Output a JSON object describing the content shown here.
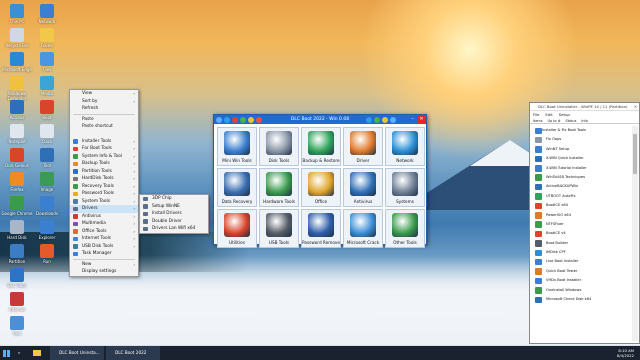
{
  "desktop": {
    "icons_left": [
      {
        "label": "This PC",
        "color": "#3a8fd9"
      },
      {
        "label": "Recycle Bin",
        "color": "#cfd8e3"
      },
      {
        "label": "Microsoft Edge",
        "color": "#2b88d8"
      },
      {
        "label": "Windows Defender",
        "color": "#f0c23b"
      },
      {
        "label": "Acronis",
        "color": "#2c6fbd"
      },
      {
        "label": "Notepad",
        "color": "#e0e6ee"
      },
      {
        "label": "Disk Genius",
        "color": "#d9452b"
      },
      {
        "label": "Firefox",
        "color": "#f08b23"
      },
      {
        "label": "Google Chrome",
        "color": "#3a9b4c"
      },
      {
        "label": "Hard Disk",
        "color": "#a9b6c7"
      },
      {
        "label": "Partition",
        "color": "#3b7cc4"
      },
      {
        "label": "DLC Boot",
        "color": "#2d74c9"
      },
      {
        "label": "Internet",
        "color": "#c73a3a"
      },
      {
        "label": "Task",
        "color": "#4c8fd9"
      }
    ],
    "icons_right": [
      {
        "label": "Network",
        "color": "#3b7fd0"
      },
      {
        "label": "Folder",
        "color": "#f2c84b"
      },
      {
        "label": "Files",
        "color": "#4b96df"
      },
      {
        "label": "Media",
        "color": "#3aa5d6"
      },
      {
        "label": "Boot",
        "color": "#d9452b"
      },
      {
        "label": "Clock",
        "color": "#e0e6ee"
      },
      {
        "label": "Tool",
        "color": "#2f6fb6"
      },
      {
        "label": "Image",
        "color": "#3b9a57"
      },
      {
        "label": "Downloads",
        "color": "#3b7fd0"
      },
      {
        "label": "Explorer",
        "color": "#3b7fd0"
      },
      {
        "label": "Run",
        "color": "#e35a2b"
      }
    ]
  },
  "context_menu": {
    "top_items": [
      "View",
      "Sort by",
      "Refresh"
    ],
    "group1": [
      "Paste",
      "Paste shortcut"
    ],
    "header": "",
    "tools": [
      {
        "label": "Installer Tools",
        "color": "#3b7fd0"
      },
      {
        "label": "For Boot Tools",
        "color": "#d9452b"
      },
      {
        "label": "System Info & Tool",
        "color": "#3a9b4c"
      },
      {
        "label": "Backup Tools",
        "color": "#e38a2b"
      },
      {
        "label": "Partition Tools",
        "color": "#2f6fb6"
      },
      {
        "label": "HardDisk Tools",
        "color": "#777777"
      },
      {
        "label": "Recovery Tools",
        "color": "#3a9b4c"
      },
      {
        "label": "Password Tools",
        "color": "#d9b02b"
      },
      {
        "label": "System Tools",
        "color": "#4c7fa8"
      },
      {
        "label": "Drivers",
        "color": "#5a6f8a"
      },
      {
        "label": "Antivirus",
        "color": "#c73a3a"
      },
      {
        "label": "Multimedia",
        "color": "#7a4cc7"
      },
      {
        "label": "Office Tools",
        "color": "#e36a2b"
      },
      {
        "label": "Internet Tools",
        "color": "#2f8fd6"
      },
      {
        "label": "USB Disk Tools",
        "color": "#3a7f9b"
      },
      {
        "label": "Task Manager",
        "color": "#3b7fd0"
      }
    ],
    "bottom_items": [
      "New",
      "Display settings"
    ],
    "submenu": [
      "3DP Chip",
      "Setup WinNE",
      "Install Drivers",
      "Double Driver",
      "Drivers Lan Wifi x64"
    ]
  },
  "dlc_window": {
    "title": "DLC Boot 2022 - Win 0.08",
    "tiles": [
      {
        "label": "Mini Win Tools",
        "color": "#3b7fd0"
      },
      {
        "label": "Disk Tools",
        "color": "#8a96a6"
      },
      {
        "label": "Backup & Restore",
        "color": "#2fa35a"
      },
      {
        "label": "Driver",
        "color": "#e07a2b"
      },
      {
        "label": "Network",
        "color": "#2a8fd6"
      },
      {
        "label": "Data Recovery",
        "color": "#3b6fb0"
      },
      {
        "label": "Hardware Tools",
        "color": "#3a9b4c"
      },
      {
        "label": "Office",
        "color": "#e0a52b"
      },
      {
        "label": "Antivirus",
        "color": "#2f6fb6"
      },
      {
        "label": "Systems",
        "color": "#6f7f95"
      },
      {
        "label": "Utilities",
        "color": "#d9452b"
      },
      {
        "label": "USB Tools",
        "color": "#555c66"
      },
      {
        "label": "Password Remove",
        "color": "#2f5fa8"
      },
      {
        "label": "Microsoft Crack",
        "color": "#3b8fd6"
      },
      {
        "label": "Other Tools",
        "color": "#3a9b4c"
      }
    ]
  },
  "tool_window": {
    "title": "DLC Boot Uninstaller - WinPE 10 / 11 (Partition)",
    "menu": [
      "File",
      "Edit",
      "Setup"
    ],
    "tabs": [
      "Items",
      "Up to #",
      "Status",
      "Info"
    ],
    "items": [
      {
        "label": "Installer & Fix Boot Tools",
        "color": "#3b7fd0"
      },
      {
        "label": "Fix Oops",
        "color": "#8a96a6"
      },
      {
        "label": "WinNT Setup",
        "color": "#3b7fd0"
      },
      {
        "label": "X-WIN Quick Installer",
        "color": "#2f6fb6"
      },
      {
        "label": "X-WIN Tutorial Installer",
        "color": "#3b7fd0"
      },
      {
        "label": "WinToUSB Techniques",
        "color": "#3a9b4c"
      },
      {
        "label": "ActiveBACKUPWin",
        "color": "#2f6fb6"
      },
      {
        "label": "UTBOOT AutoFix",
        "color": "#2fa35a"
      },
      {
        "label": "BootICE x64",
        "color": "#d9452b"
      },
      {
        "label": "PowerISO x64",
        "color": "#e07a2b"
      },
      {
        "label": "NTFSFixer",
        "color": "#3a9b4c"
      },
      {
        "label": "BootICE v4",
        "color": "#d9452b"
      },
      {
        "label": "Boot Builder",
        "color": "#555c66"
      },
      {
        "label": "IMDisk CPF",
        "color": "#2a8fd6"
      },
      {
        "label": "Live Boot Installer",
        "color": "#3b7fd0"
      },
      {
        "label": "Quick Boot Tester",
        "color": "#e07a2b"
      },
      {
        "label": "VHDx Boot Installer",
        "color": "#3b7fd0"
      },
      {
        "label": "OneInstall Windows",
        "color": "#3a9b4c"
      },
      {
        "label": "Microsoft Check Disk x64",
        "color": "#2f6fb6"
      }
    ]
  },
  "taskbar": {
    "buttons": [
      "DLC Boot Uninsta...",
      "DLC Boot 2022"
    ],
    "time": "8:10 AM",
    "date": "8/4/2022"
  }
}
